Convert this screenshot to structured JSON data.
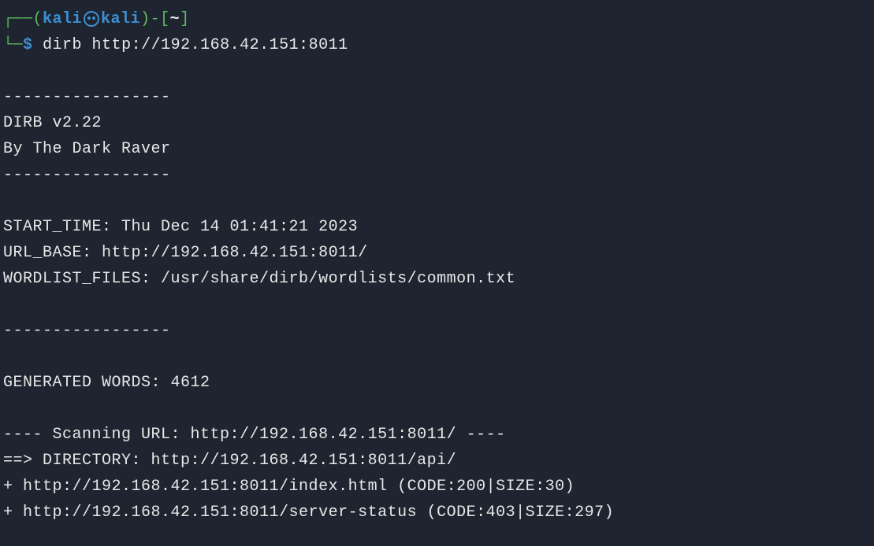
{
  "prompt": {
    "user": "kali",
    "host": "kali",
    "path": "~",
    "symbol": "$"
  },
  "command": "dirb http://192.168.42.151:8011",
  "output": {
    "sep1": "-----------------",
    "header1": "DIRB v2.22",
    "header2": "By The Dark Raver",
    "sep2": "-----------------",
    "starttime": "START_TIME: Thu Dec 14 01:41:21 2023",
    "urlbase": "URL_BASE: http://192.168.42.151:8011/",
    "wordlist": "WORDLIST_FILES: /usr/share/dirb/wordlists/common.txt",
    "sep3": "-----------------",
    "generated": "GENERATED WORDS: 4612",
    "scanning": "---- Scanning URL: http://192.168.42.151:8011/ ----",
    "directory": "==> DIRECTORY: http://192.168.42.151:8011/api/",
    "result1": "+ http://192.168.42.151:8011/index.html (CODE:200|SIZE:30)",
    "result2": "+ http://192.168.42.151:8011/server-status (CODE:403|SIZE:297)"
  }
}
